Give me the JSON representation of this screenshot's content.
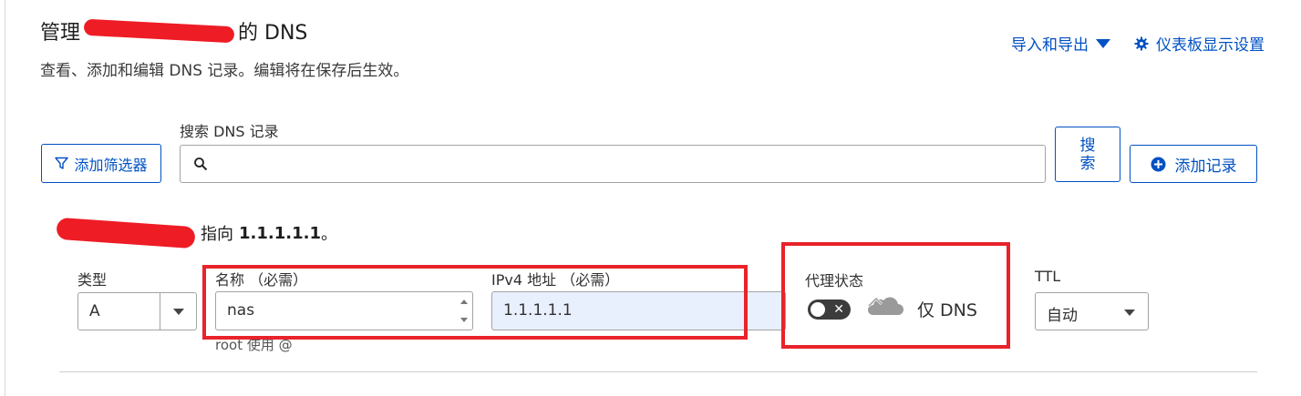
{
  "header": {
    "title_prefix": "管理",
    "title_suffix": "的 DNS",
    "subtitle": "查看、添加和编辑 DNS 记录。编辑将在保存后生效。",
    "import_export_label": "导入和导出",
    "dashboard_settings_label": "仪表板显示设置"
  },
  "search": {
    "label": "搜索 DNS 记录",
    "value": "",
    "placeholder": "",
    "button_label_1": "搜",
    "button_label_2": "索"
  },
  "filter": {
    "add_filter_label": "添加筛选器"
  },
  "add_record": {
    "label": "添加记录"
  },
  "record_preview": {
    "points_to": "指向",
    "target": "1.1.1.1.1",
    "period": "。"
  },
  "form": {
    "type_label": "类型",
    "type_value": "A",
    "name_label": "名称 （必需）",
    "name_value": "nas",
    "name_hint": "root 使用 @",
    "ipv4_label": "IPv4 地址 （必需）",
    "ipv4_value": "1.1.1.1.1",
    "proxy_label": "代理状态",
    "proxy_state_text": "仅 DNS",
    "ttl_label": "TTL",
    "ttl_value": "自动"
  },
  "colors": {
    "accent": "#0051c3",
    "highlight": "#e8232a",
    "redaction": "#ee1c25",
    "autofill_bg": "#e8f0fe",
    "toggle_bg": "#3c3c3c"
  },
  "icons": {
    "import_export": "chevron-down-icon",
    "settings": "gear-icon",
    "filter": "funnel-icon",
    "search": "search-icon",
    "add": "plus-circle-icon",
    "proxy": "cloud-icon"
  }
}
